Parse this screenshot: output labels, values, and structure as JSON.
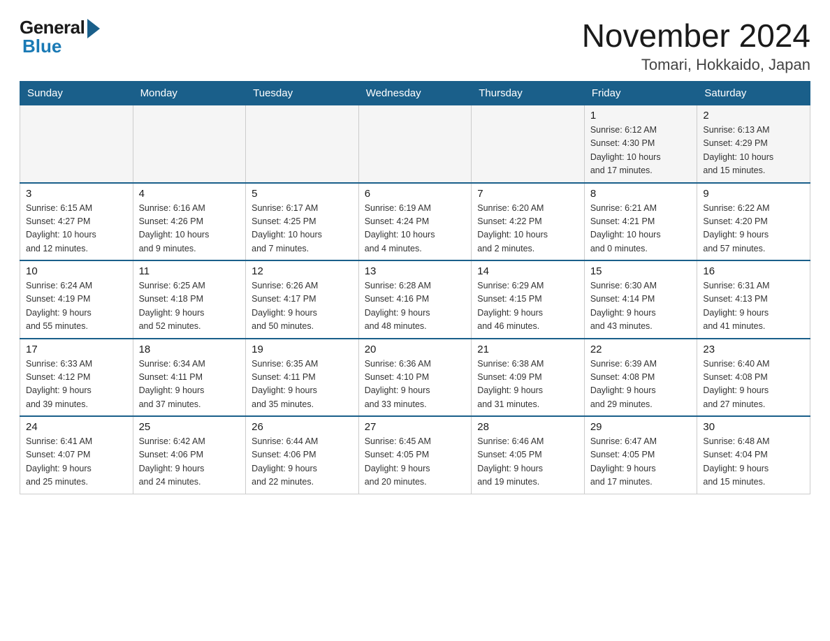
{
  "header": {
    "logo_general": "General",
    "logo_blue": "Blue",
    "month_year": "November 2024",
    "location": "Tomari, Hokkaido, Japan"
  },
  "days_of_week": [
    "Sunday",
    "Monday",
    "Tuesday",
    "Wednesday",
    "Thursday",
    "Friday",
    "Saturday"
  ],
  "weeks": [
    [
      {
        "num": "",
        "info": ""
      },
      {
        "num": "",
        "info": ""
      },
      {
        "num": "",
        "info": ""
      },
      {
        "num": "",
        "info": ""
      },
      {
        "num": "",
        "info": ""
      },
      {
        "num": "1",
        "info": "Sunrise: 6:12 AM\nSunset: 4:30 PM\nDaylight: 10 hours\nand 17 minutes."
      },
      {
        "num": "2",
        "info": "Sunrise: 6:13 AM\nSunset: 4:29 PM\nDaylight: 10 hours\nand 15 minutes."
      }
    ],
    [
      {
        "num": "3",
        "info": "Sunrise: 6:15 AM\nSunset: 4:27 PM\nDaylight: 10 hours\nand 12 minutes."
      },
      {
        "num": "4",
        "info": "Sunrise: 6:16 AM\nSunset: 4:26 PM\nDaylight: 10 hours\nand 9 minutes."
      },
      {
        "num": "5",
        "info": "Sunrise: 6:17 AM\nSunset: 4:25 PM\nDaylight: 10 hours\nand 7 minutes."
      },
      {
        "num": "6",
        "info": "Sunrise: 6:19 AM\nSunset: 4:24 PM\nDaylight: 10 hours\nand 4 minutes."
      },
      {
        "num": "7",
        "info": "Sunrise: 6:20 AM\nSunset: 4:22 PM\nDaylight: 10 hours\nand 2 minutes."
      },
      {
        "num": "8",
        "info": "Sunrise: 6:21 AM\nSunset: 4:21 PM\nDaylight: 10 hours\nand 0 minutes."
      },
      {
        "num": "9",
        "info": "Sunrise: 6:22 AM\nSunset: 4:20 PM\nDaylight: 9 hours\nand 57 minutes."
      }
    ],
    [
      {
        "num": "10",
        "info": "Sunrise: 6:24 AM\nSunset: 4:19 PM\nDaylight: 9 hours\nand 55 minutes."
      },
      {
        "num": "11",
        "info": "Sunrise: 6:25 AM\nSunset: 4:18 PM\nDaylight: 9 hours\nand 52 minutes."
      },
      {
        "num": "12",
        "info": "Sunrise: 6:26 AM\nSunset: 4:17 PM\nDaylight: 9 hours\nand 50 minutes."
      },
      {
        "num": "13",
        "info": "Sunrise: 6:28 AM\nSunset: 4:16 PM\nDaylight: 9 hours\nand 48 minutes."
      },
      {
        "num": "14",
        "info": "Sunrise: 6:29 AM\nSunset: 4:15 PM\nDaylight: 9 hours\nand 46 minutes."
      },
      {
        "num": "15",
        "info": "Sunrise: 6:30 AM\nSunset: 4:14 PM\nDaylight: 9 hours\nand 43 minutes."
      },
      {
        "num": "16",
        "info": "Sunrise: 6:31 AM\nSunset: 4:13 PM\nDaylight: 9 hours\nand 41 minutes."
      }
    ],
    [
      {
        "num": "17",
        "info": "Sunrise: 6:33 AM\nSunset: 4:12 PM\nDaylight: 9 hours\nand 39 minutes."
      },
      {
        "num": "18",
        "info": "Sunrise: 6:34 AM\nSunset: 4:11 PM\nDaylight: 9 hours\nand 37 minutes."
      },
      {
        "num": "19",
        "info": "Sunrise: 6:35 AM\nSunset: 4:11 PM\nDaylight: 9 hours\nand 35 minutes."
      },
      {
        "num": "20",
        "info": "Sunrise: 6:36 AM\nSunset: 4:10 PM\nDaylight: 9 hours\nand 33 minutes."
      },
      {
        "num": "21",
        "info": "Sunrise: 6:38 AM\nSunset: 4:09 PM\nDaylight: 9 hours\nand 31 minutes."
      },
      {
        "num": "22",
        "info": "Sunrise: 6:39 AM\nSunset: 4:08 PM\nDaylight: 9 hours\nand 29 minutes."
      },
      {
        "num": "23",
        "info": "Sunrise: 6:40 AM\nSunset: 4:08 PM\nDaylight: 9 hours\nand 27 minutes."
      }
    ],
    [
      {
        "num": "24",
        "info": "Sunrise: 6:41 AM\nSunset: 4:07 PM\nDaylight: 9 hours\nand 25 minutes."
      },
      {
        "num": "25",
        "info": "Sunrise: 6:42 AM\nSunset: 4:06 PM\nDaylight: 9 hours\nand 24 minutes."
      },
      {
        "num": "26",
        "info": "Sunrise: 6:44 AM\nSunset: 4:06 PM\nDaylight: 9 hours\nand 22 minutes."
      },
      {
        "num": "27",
        "info": "Sunrise: 6:45 AM\nSunset: 4:05 PM\nDaylight: 9 hours\nand 20 minutes."
      },
      {
        "num": "28",
        "info": "Sunrise: 6:46 AM\nSunset: 4:05 PM\nDaylight: 9 hours\nand 19 minutes."
      },
      {
        "num": "29",
        "info": "Sunrise: 6:47 AM\nSunset: 4:05 PM\nDaylight: 9 hours\nand 17 minutes."
      },
      {
        "num": "30",
        "info": "Sunrise: 6:48 AM\nSunset: 4:04 PM\nDaylight: 9 hours\nand 15 minutes."
      }
    ]
  ]
}
